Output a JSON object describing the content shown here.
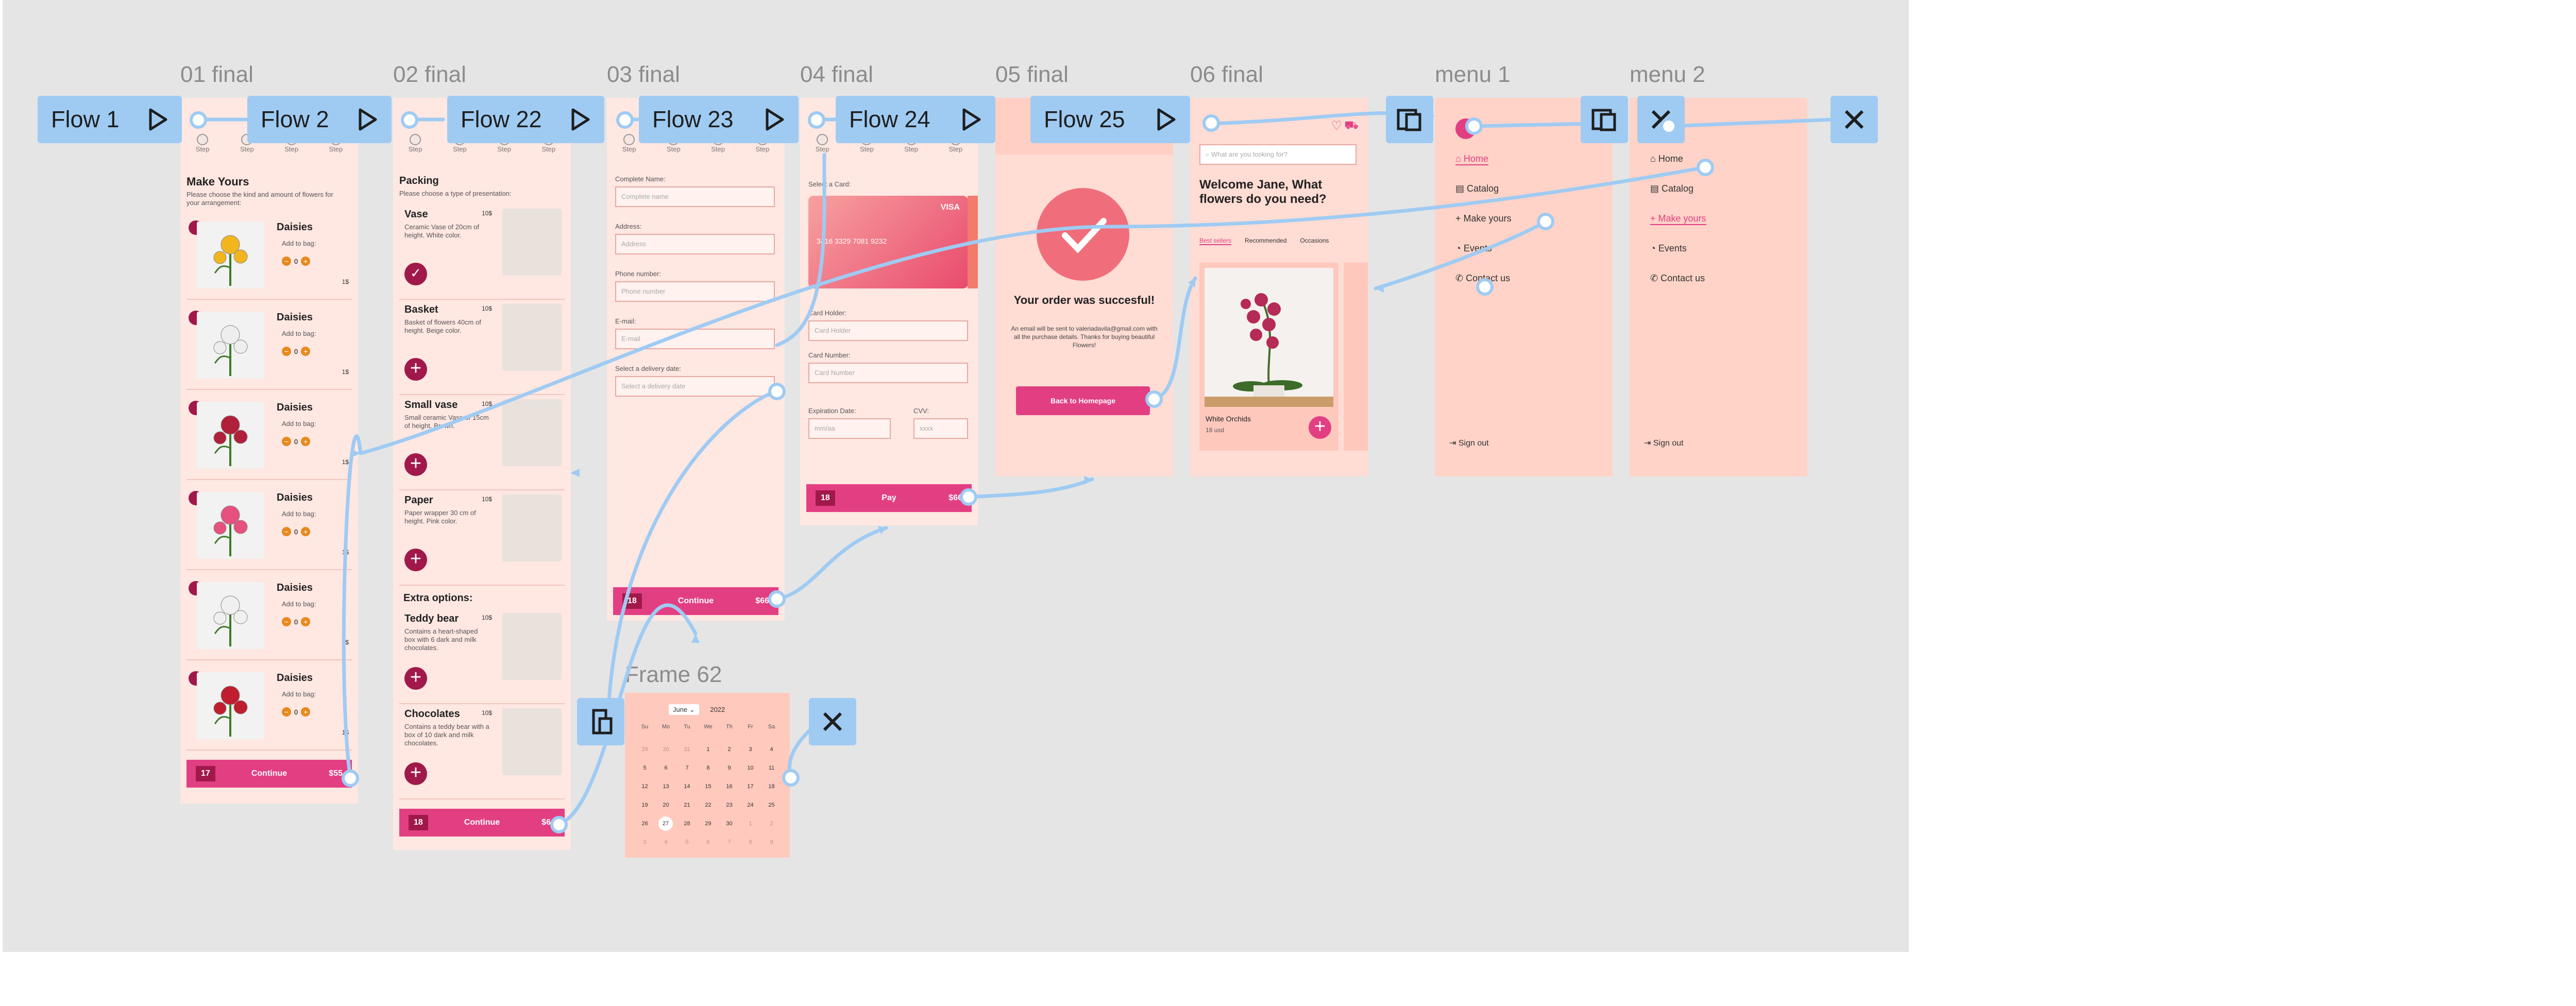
{
  "canvas": {
    "bg": "#e5e5e5",
    "accent": "#9fcbf3",
    "brand": "#e23f83",
    "dark_brand": "#a0194a"
  },
  "frame_labels": {
    "f01": "01 final",
    "f02": "02 final",
    "f03": "03 final",
    "f04": "04 final",
    "f05": "05 final",
    "f06": "06 final",
    "m1": "menu 1",
    "m2": "menu 2",
    "frame62": "Frame 62"
  },
  "flows": {
    "flow1": "Flow 1",
    "flow2": "Flow 2",
    "flow22": "Flow 22",
    "flow23": "Flow 23",
    "flow24": "Flow 24",
    "flow25": "Flow 25"
  },
  "step_label": "Step",
  "screen01": {
    "title": "Make Yours",
    "subtitle": "Please choose the kind and amount of flowers for your arrangement:",
    "items": [
      {
        "name": "Daisies",
        "add": "Add to bag:",
        "qty": "0",
        "price": "1$"
      },
      {
        "name": "Daisies",
        "add": "Add to bag:",
        "qty": "0",
        "price": "1$"
      },
      {
        "name": "Daisies",
        "add": "Add to bag:",
        "qty": "0",
        "price": "1$"
      },
      {
        "name": "Daisies",
        "add": "Add to bag:",
        "qty": "0",
        "price": "1$"
      },
      {
        "name": "Daisies",
        "add": "Add to bag:",
        "qty": "0",
        "price": "1$"
      },
      {
        "name": "Daisies",
        "add": "Add to bag:",
        "qty": "0",
        "price": "1$"
      }
    ],
    "bar": {
      "badge": "17",
      "label": "Continue",
      "amount": "$55"
    }
  },
  "screen02": {
    "title": "Packing",
    "subtitle": "Please choose a type of presentation:",
    "items": [
      {
        "name": "Vase",
        "price": "10$",
        "desc": "Ceramic Vase of 20cm of height. White color."
      },
      {
        "name": "Basket",
        "price": "10$",
        "desc": "Basket of flowers 40cm of height. Beige color."
      },
      {
        "name": "Small vase",
        "price": "10$",
        "desc": "Small ceramic Vase of 15cm of height. Brown."
      },
      {
        "name": "Paper",
        "price": "10$",
        "desc": "Paper wrapper 30 cm of height. Pink color."
      }
    ],
    "extra_title": "Extra options:",
    "extras": [
      {
        "name": "Teddy bear",
        "price": "10$",
        "desc": "Contains a heart-shaped box with 6 dark and milk chocolates."
      },
      {
        "name": "Chocolates",
        "price": "10$",
        "desc": "Contains a teddy bear with a box of 10 dark and milk chocolates."
      }
    ],
    "bar": {
      "badge": "18",
      "label": "Continue",
      "amount": "$66"
    }
  },
  "screen03": {
    "fields": [
      {
        "label": "Complete Name:",
        "placeholder": "Complete name"
      },
      {
        "label": "Address:",
        "placeholder": "Address"
      },
      {
        "label": "Phone number:",
        "placeholder": "Phone number"
      },
      {
        "label": "E-mail:",
        "placeholder": "E-mail"
      },
      {
        "label": "Select a delivery date:",
        "placeholder": "Select a delivery date"
      }
    ],
    "bar": {
      "badge": "18",
      "label": "Continue",
      "amount": "$66"
    }
  },
  "screen04": {
    "card_label": "Select a Card:",
    "card_brand": "VISA",
    "card_number": "3416 3329 7081 9232",
    "holder_label": "Card Holder:",
    "holder_placeholder": "Card Holder",
    "number_label": "Card Number:",
    "number_placeholder": "Card Number",
    "exp_label": "Expiration Date:",
    "exp_placeholder": "mm/aa",
    "cvv_label": "CVV:",
    "cvv_placeholder": "xxxx",
    "bar": {
      "badge": "18",
      "label": "Pay",
      "amount": "$66"
    }
  },
  "screen05": {
    "title": "Your order was succesful!",
    "body": "An email will be sent to valeriadavila@gmail.com with all the purchase details. Thanks for buying beautiful Flowers!",
    "button": "Back to Homepage"
  },
  "screen06": {
    "search_placeholder": "What are you looking for?",
    "welcome": "Welcome Jane, What flowers do you need?",
    "tabs": [
      "Best sellers",
      "Recommended",
      "Occasions"
    ],
    "product": {
      "name": "White Orchids",
      "price": "18 usd"
    }
  },
  "menu1": {
    "items": [
      "Home",
      "Catalog",
      "Make yours",
      "Events",
      "Contact us"
    ],
    "signout": "Sign out"
  },
  "menu2": {
    "items": [
      "Home",
      "Catalog",
      "Make yours",
      "Events",
      "Contact us"
    ],
    "signout": "Sign out"
  },
  "calendar": {
    "month": "June",
    "year": "2022",
    "weekdays": [
      "Su",
      "Mo",
      "Tu",
      "We",
      "Th",
      "Fr",
      "Sa"
    ],
    "weeks": [
      [
        "29",
        "30",
        "31",
        "1",
        "2",
        "3",
        "4"
      ],
      [
        "5",
        "6",
        "7",
        "8",
        "9",
        "10",
        "11"
      ],
      [
        "12",
        "13",
        "14",
        "15",
        "16",
        "17",
        "18"
      ],
      [
        "19",
        "20",
        "21",
        "22",
        "23",
        "24",
        "25"
      ],
      [
        "26",
        "27",
        "28",
        "29",
        "30",
        "1",
        "2"
      ],
      [
        "3",
        "4",
        "5",
        "6",
        "7",
        "8",
        "9"
      ]
    ],
    "selected": "27"
  }
}
